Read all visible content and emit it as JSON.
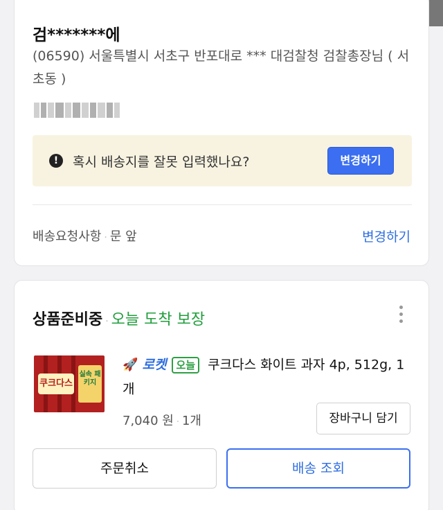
{
  "address_card": {
    "recipient_name": "검*******에",
    "address_text": "(06590) 서울특별시 서초구 반포대로 *** 대검찰청 검찰총장님 ( 서초동 )",
    "phone_masked": "010-****-****",
    "warning": {
      "icon": "exclamation-circle-icon",
      "message": "혹시 배송지를 잘못 입력했나요?",
      "button_label": "변경하기"
    },
    "delivery_request": {
      "label": "배송요청사항",
      "separator": "·",
      "value": "문 앞",
      "change_label": "변경하기"
    }
  },
  "order_card": {
    "status": "상품준비중",
    "status_separator": "·",
    "status_detail": "오늘 도착 보장",
    "more_icon": "more-vertical-icon",
    "product": {
      "thumbnail_text_left": "쿠크다스",
      "thumbnail_text_right": "실속 패키지",
      "rocket_icon": "rocket-icon",
      "rocket_label": "로켓",
      "today_badge": "오늘",
      "name": "쿠크다스 화이트 과자 4p, 512g, 1개",
      "price": "7,040 원",
      "price_separator": "·",
      "quantity": "1개",
      "cart_button": "장바구니 담기"
    },
    "cancel_button": "주문취소",
    "track_button": "배송 조회"
  },
  "colors": {
    "accent_blue": "#3b6ef0",
    "link_blue": "#2e6ee0",
    "green": "#1f9e3b",
    "warning_bg": "#f8f3e1"
  }
}
